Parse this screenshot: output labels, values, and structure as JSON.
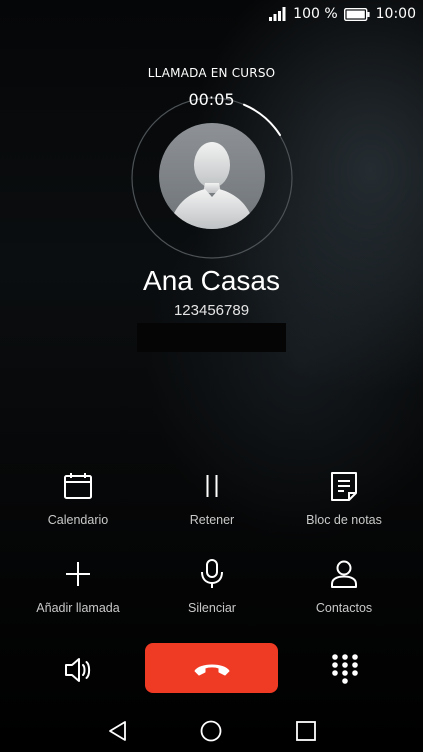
{
  "status_bar": {
    "battery_text": "100 %",
    "time": "10:00",
    "icons": [
      "signal-icon",
      "battery-icon"
    ]
  },
  "call": {
    "status": "LLAMADA EN CURSO",
    "timer": "00:05",
    "contact_name": "Ana Casas",
    "contact_number": "123456789"
  },
  "actions": [
    {
      "label": "Calendario",
      "icon": "calendar-icon"
    },
    {
      "label": "Retener",
      "icon": "pause-icon"
    },
    {
      "label": "Bloc de notas",
      "icon": "notes-icon"
    },
    {
      "label": "Añadir llamada",
      "icon": "plus-icon"
    },
    {
      "label": "Silenciar",
      "icon": "microphone-icon"
    },
    {
      "label": "Contactos",
      "icon": "person-icon"
    }
  ],
  "controls": {
    "speaker_icon": "speaker-icon",
    "end_call_icon": "phone-hangup-icon",
    "keypad_icon": "dialpad-icon",
    "end_call_color": "#ef3a24"
  },
  "nav": {
    "icons": [
      "back-triangle-icon",
      "home-circle-icon",
      "recents-square-icon"
    ]
  }
}
